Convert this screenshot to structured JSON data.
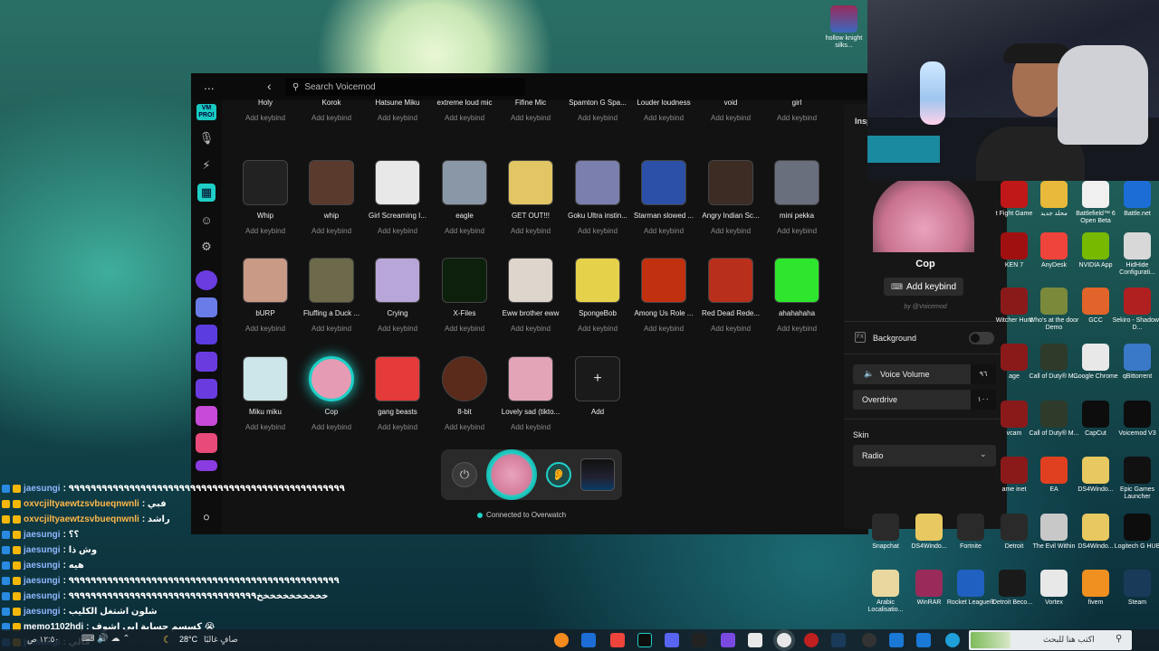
{
  "voicemod": {
    "menu": "...",
    "back": "‹",
    "search_placeholder": "Search Voicemod",
    "logo": "VM",
    "logo_badge": "PRO!",
    "row0": [
      {
        "name": "Holy",
        "keybind": "Add keybind"
      },
      {
        "name": "Korok",
        "keybind": "Add keybind"
      },
      {
        "name": "Hatsune Miku",
        "keybind": "Add keybind"
      },
      {
        "name": "extreme loud mic",
        "keybind": "Add keybind"
      },
      {
        "name": "Fifine Mic",
        "keybind": "Add keybind"
      },
      {
        "name": "Spamton G Spa...",
        "keybind": "Add keybind"
      },
      {
        "name": "Louder loudness",
        "keybind": "Add keybind"
      },
      {
        "name": "void",
        "keybind": "Add keybind"
      },
      {
        "name": "girl",
        "keybind": "Add keybind"
      }
    ],
    "row1": [
      {
        "name": "Whip",
        "keybind": "Add keybind",
        "color": "#222"
      },
      {
        "name": "whip",
        "keybind": "Add keybind",
        "color": "#5a3a2c"
      },
      {
        "name": "Girl Screaming I...",
        "keybind": "Add keybind",
        "color": "#e8e8e8"
      },
      {
        "name": "eagle",
        "keybind": "Add keybind",
        "color": "#8a97a6"
      },
      {
        "name": "GET OUT!!!",
        "keybind": "Add keybind",
        "color": "#e2c564"
      },
      {
        "name": "Goku Ultra instin...",
        "keybind": "Add keybind",
        "color": "#7a7fae"
      },
      {
        "name": "Starman slowed ...",
        "keybind": "Add keybind",
        "color": "#2c4fa8"
      },
      {
        "name": "Angry Indian Sc...",
        "keybind": "Add keybind",
        "color": "#3c2c24"
      },
      {
        "name": "mini pekka",
        "keybind": "Add keybind",
        "color": "#6a6f7e"
      }
    ],
    "row2": [
      {
        "name": "bURP",
        "keybind": "Add keybind",
        "color": "#c99a86"
      },
      {
        "name": "Fluffing a Duck ...",
        "keybind": "Add keybind",
        "color": "#6c6a4a"
      },
      {
        "name": "Crying",
        "keybind": "Add keybind",
        "color": "#b9a6d8"
      },
      {
        "name": "X-Files",
        "keybind": "Add keybind",
        "color": "#0c200c"
      },
      {
        "name": "Eww brother eww",
        "keybind": "Add keybind",
        "color": "#ded6cc"
      },
      {
        "name": "SpongeBob",
        "keybind": "Add keybind",
        "color": "#e6d24a"
      },
      {
        "name": "Among Us Role ...",
        "keybind": "Add keybind",
        "color": "#c2310f"
      },
      {
        "name": "Red Dead Rede...",
        "keybind": "Add keybind",
        "color": "#b8301c"
      },
      {
        "name": "ahahahaha",
        "keybind": "Add keybind",
        "color": "#2ee62e"
      }
    ],
    "row3": [
      {
        "name": "Miku miku",
        "keybind": "Add keybind",
        "color": "#cde6ea"
      },
      {
        "name": "Cop",
        "keybind": "Add keybind",
        "color": "#e59bb4"
      },
      {
        "name": "gang beasts",
        "keybind": "Add keybind",
        "color": "#e53a3a"
      },
      {
        "name": "8-bit",
        "keybind": "Add keybind",
        "color": "#5a2a1a"
      },
      {
        "name": "Lovely sad (tikto...",
        "keybind": "Add keybind",
        "color": "#e3a4b8"
      },
      {
        "name": "Add",
        "keybind": "",
        "color": "#1a1a1a"
      }
    ],
    "add_plus": "+",
    "connected": "Connected to Overwatch",
    "inspector": {
      "tab": "Insp",
      "voice_name": "Cop",
      "add_keybind": "Add keybind",
      "by": "by @Voicemod",
      "background_label": "Background",
      "fx": "FX",
      "voice_volume_label": "Voice Volume",
      "voice_volume_value": "٩٦",
      "overdrive_label": "Overdrive",
      "overdrive_value": "١٠٠",
      "skin_label": "Skin",
      "skin_value": "Radio"
    }
  },
  "desktop": {
    "top_icon": "hollow knight silks...",
    "icons": [
      {
        "label": "Battle.net",
        "color": "#1c6ed6"
      },
      {
        "label": "Battlefield™ 6 Open Beta",
        "color": "#f0f0f0"
      },
      {
        "label": "محلد جديد",
        "color": "#e8b93a"
      },
      {
        "label": "t Fight Game",
        "color": "#c01818"
      },
      {
        "label": "HidHide Configurati...",
        "color": "#d8d8d8"
      },
      {
        "label": "NVIDIA App",
        "color": "#76b900"
      },
      {
        "label": "AnyDesk",
        "color": "#ef443b"
      },
      {
        "label": "KEN 7",
        "color": "#a01010"
      },
      {
        "label": "Sekiro - Shadows D...",
        "color": "#b02020"
      },
      {
        "label": "GCC",
        "color": "#e2642a"
      },
      {
        "label": "Who's at the door Demo",
        "color": "#7a8a3a"
      },
      {
        "label": "Witcher Hunt",
        "color": "#8a1a1a"
      },
      {
        "label": "qBittorrent",
        "color": "#3a78c8"
      },
      {
        "label": "Google Chrome",
        "color": "#e8e8e8"
      },
      {
        "label": "Call of Duty® M...",
        "color": "#2e3a2a"
      },
      {
        "label": "age",
        "color": "#8a1a1a"
      },
      {
        "label": "Voicemod V3",
        "color": "#0d0d0d"
      },
      {
        "label": "CapCut",
        "color": "#0d0d0d"
      },
      {
        "label": "Call of Duty® M...",
        "color": "#2e3a2a"
      },
      {
        "label": "vcam",
        "color": "#8a1a1a"
      },
      {
        "label": "Epic Games Launcher",
        "color": "#111"
      },
      {
        "label": "DS4Windo...",
        "color": "#e8c860"
      },
      {
        "label": "EA",
        "color": "#e04020"
      },
      {
        "label": "ame inet",
        "color": "#8a1a1a"
      },
      {
        "label": "Logitech G HUB",
        "color": "#0d0d0d"
      },
      {
        "label": "DS4Windo...",
        "color": "#e8c860"
      },
      {
        "label": "The Evil Within",
        "color": "#c8c8c8"
      },
      {
        "label": "Detroit",
        "color": "#2a2a2a"
      },
      {
        "label": "Fortnite",
        "color": "#2a2a2a"
      },
      {
        "label": "DS4Windo...",
        "color": "#e8c860"
      },
      {
        "label": "Snapchat",
        "color": "#2a2a2a"
      },
      {
        "label": "Steam",
        "color": "#1a3a5a"
      },
      {
        "label": "fivem",
        "color": "#f09020"
      },
      {
        "label": "Vortex",
        "color": "#e8e8e8"
      },
      {
        "label": "Detroit Beco...",
        "color": "#1a1a1a"
      },
      {
        "label": "Rocket League®",
        "color": "#2060c0"
      },
      {
        "label": "WinRAR",
        "color": "#9a2a5a"
      },
      {
        "label": "Arabic Localisatio...",
        "color": "#e8d8a0"
      }
    ]
  },
  "chat": [
    {
      "user": "jaesungi",
      "msg": ": ٩٩٩٩٩٩٩٩٩٩٩٩٩٩٩٩٩٩٩٩٩٩٩٩٩٩٩٩٩٩٩٩٩٩٩٩٩٩٩٩٩٩٩٩٩٩٩٩٩٩",
      "cls": "u1"
    },
    {
      "user": "oxvcjiltyaewtzsvbueqnwnli",
      "msg": ": فبي",
      "cls": "u2"
    },
    {
      "user": "oxvcjiltyaewtzsvbueqnwnli",
      "msg": ": راشد",
      "cls": "u2"
    },
    {
      "user": "jaesungi",
      "msg": ": ؟؟",
      "cls": "u1"
    },
    {
      "user": "jaesungi",
      "msg": ": وش ذا",
      "cls": "u1"
    },
    {
      "user": "jaesungi",
      "msg": ": هيه",
      "cls": "u1"
    },
    {
      "user": "jaesungi",
      "msg": ": ٩٩٩٩٩٩٩٩٩٩٩٩٩٩٩٩٩٩٩٩٩٩٩٩٩٩٩٩٩٩٩٩٩٩٩٩٩٩٩٩٩٩٩٩٩٩٩٩٩",
      "cls": "u1"
    },
    {
      "user": "jaesungi",
      "msg": ": خخخخخخخخخخخ٩٩٩٩٩٩٩٩٩٩٩٩٩٩٩٩٩٩٩٩٩٩٩٩٩٩٩٩٩٩٩٩٩٩",
      "cls": "u1"
    },
    {
      "user": "jaesungi",
      "msg": ": شلون اشتغل الكليب",
      "cls": "u1"
    },
    {
      "user": "memo1102hdj",
      "msg": ": كسسم حسابة ابي اشوف 😭",
      "cls": "u3"
    },
    {
      "user": "jaesungi",
      "msg": ": مالي",
      "cls": "u1"
    }
  ],
  "taskbar": {
    "weather": "28°C",
    "weather_text": "صافٍ غالبًا",
    "search_placeholder": "اكتب هنا للبحث",
    "time": "١٢:٥٠ ص"
  }
}
